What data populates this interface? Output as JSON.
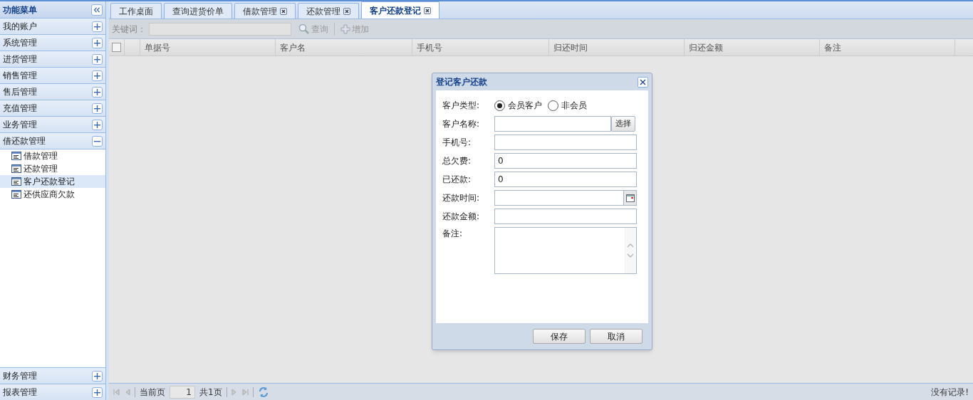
{
  "sidebar": {
    "title": "功能菜单",
    "groups": [
      {
        "label": "我的账户",
        "expanded": false
      },
      {
        "label": "系统管理",
        "expanded": false
      },
      {
        "label": "进货管理",
        "expanded": false
      },
      {
        "label": "销售管理",
        "expanded": false
      },
      {
        "label": "售后管理",
        "expanded": false
      },
      {
        "label": "充值管理",
        "expanded": false
      },
      {
        "label": "业务管理",
        "expanded": false
      },
      {
        "label": "借还款管理",
        "expanded": true,
        "children": [
          {
            "label": "借款管理",
            "selected": false
          },
          {
            "label": "还款管理",
            "selected": false
          },
          {
            "label": "客户还款登记",
            "selected": true
          },
          {
            "label": "还供应商欠款",
            "selected": false
          }
        ]
      }
    ],
    "bottom_groups": [
      {
        "label": "财务管理",
        "expanded": false
      },
      {
        "label": "报表管理",
        "expanded": false
      }
    ]
  },
  "tabs": [
    {
      "label": "工作桌面",
      "closable": false,
      "selected": false
    },
    {
      "label": "查询进货价单",
      "closable": false,
      "selected": false
    },
    {
      "label": "借款管理",
      "closable": true,
      "selected": false
    },
    {
      "label": "还款管理",
      "closable": true,
      "selected": false
    },
    {
      "label": "客户还款登记",
      "closable": true,
      "selected": true
    }
  ],
  "toolbar": {
    "keyword_label": "关键词：",
    "buttons": [
      {
        "kind": "search",
        "label": "查询"
      },
      {
        "kind": "add",
        "label": "增加"
      }
    ]
  },
  "table": {
    "select_all": {
      "checked": false
    },
    "columns": [
      "单据号",
      "客户名",
      "手机号",
      "归还时间",
      "归还金额",
      "备注"
    ]
  },
  "pager": {
    "current_label": "当前页",
    "page": "1",
    "total": "共1页",
    "status": "没有记录!"
  },
  "dialog": {
    "title": "登记客户还款",
    "fields": [
      {
        "kind": "radio",
        "label": "客户类型:",
        "options": [
          {
            "label": "会员客户",
            "selected": true
          },
          {
            "label": "非会员",
            "selected": false
          }
        ]
      },
      {
        "kind": "pick",
        "label": "客户名称:",
        "button": "选择"
      },
      {
        "kind": "text",
        "label": "手机号:"
      },
      {
        "kind": "text",
        "label": "总欠费:",
        "value": "0"
      },
      {
        "kind": "text",
        "label": "已还款:",
        "value": "0"
      },
      {
        "kind": "date",
        "label": "还款时间:"
      },
      {
        "kind": "text",
        "label": "还款金额:"
      },
      {
        "kind": "textarea",
        "label": "备注:"
      }
    ],
    "buttons": [
      "保存",
      "取消"
    ]
  }
}
